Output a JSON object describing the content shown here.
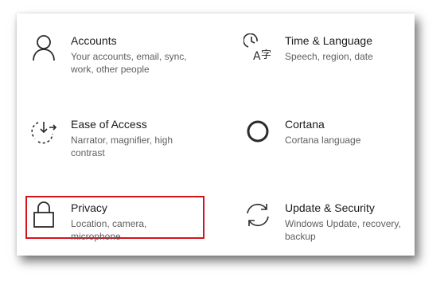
{
  "settings": {
    "tiles": [
      {
        "title": "Accounts",
        "description": "Your accounts, email, sync, work, other people",
        "icon": "person-icon"
      },
      {
        "title": "Time & Language",
        "description": "Speech, region, date",
        "icon": "time-language-icon"
      },
      {
        "title": "Ease of Access",
        "description": "Narrator, magnifier, high contrast",
        "icon": "ease-of-access-icon"
      },
      {
        "title": "Cortana",
        "description": "Cortana language",
        "icon": "cortana-icon"
      },
      {
        "title": "Privacy",
        "description": "Location, camera, microphone",
        "icon": "lock-icon",
        "highlighted": true
      },
      {
        "title": "Update & Security",
        "description": "Windows Update, recovery, backup",
        "icon": "sync-icon"
      }
    ],
    "highlight_color": "#d4141c"
  }
}
